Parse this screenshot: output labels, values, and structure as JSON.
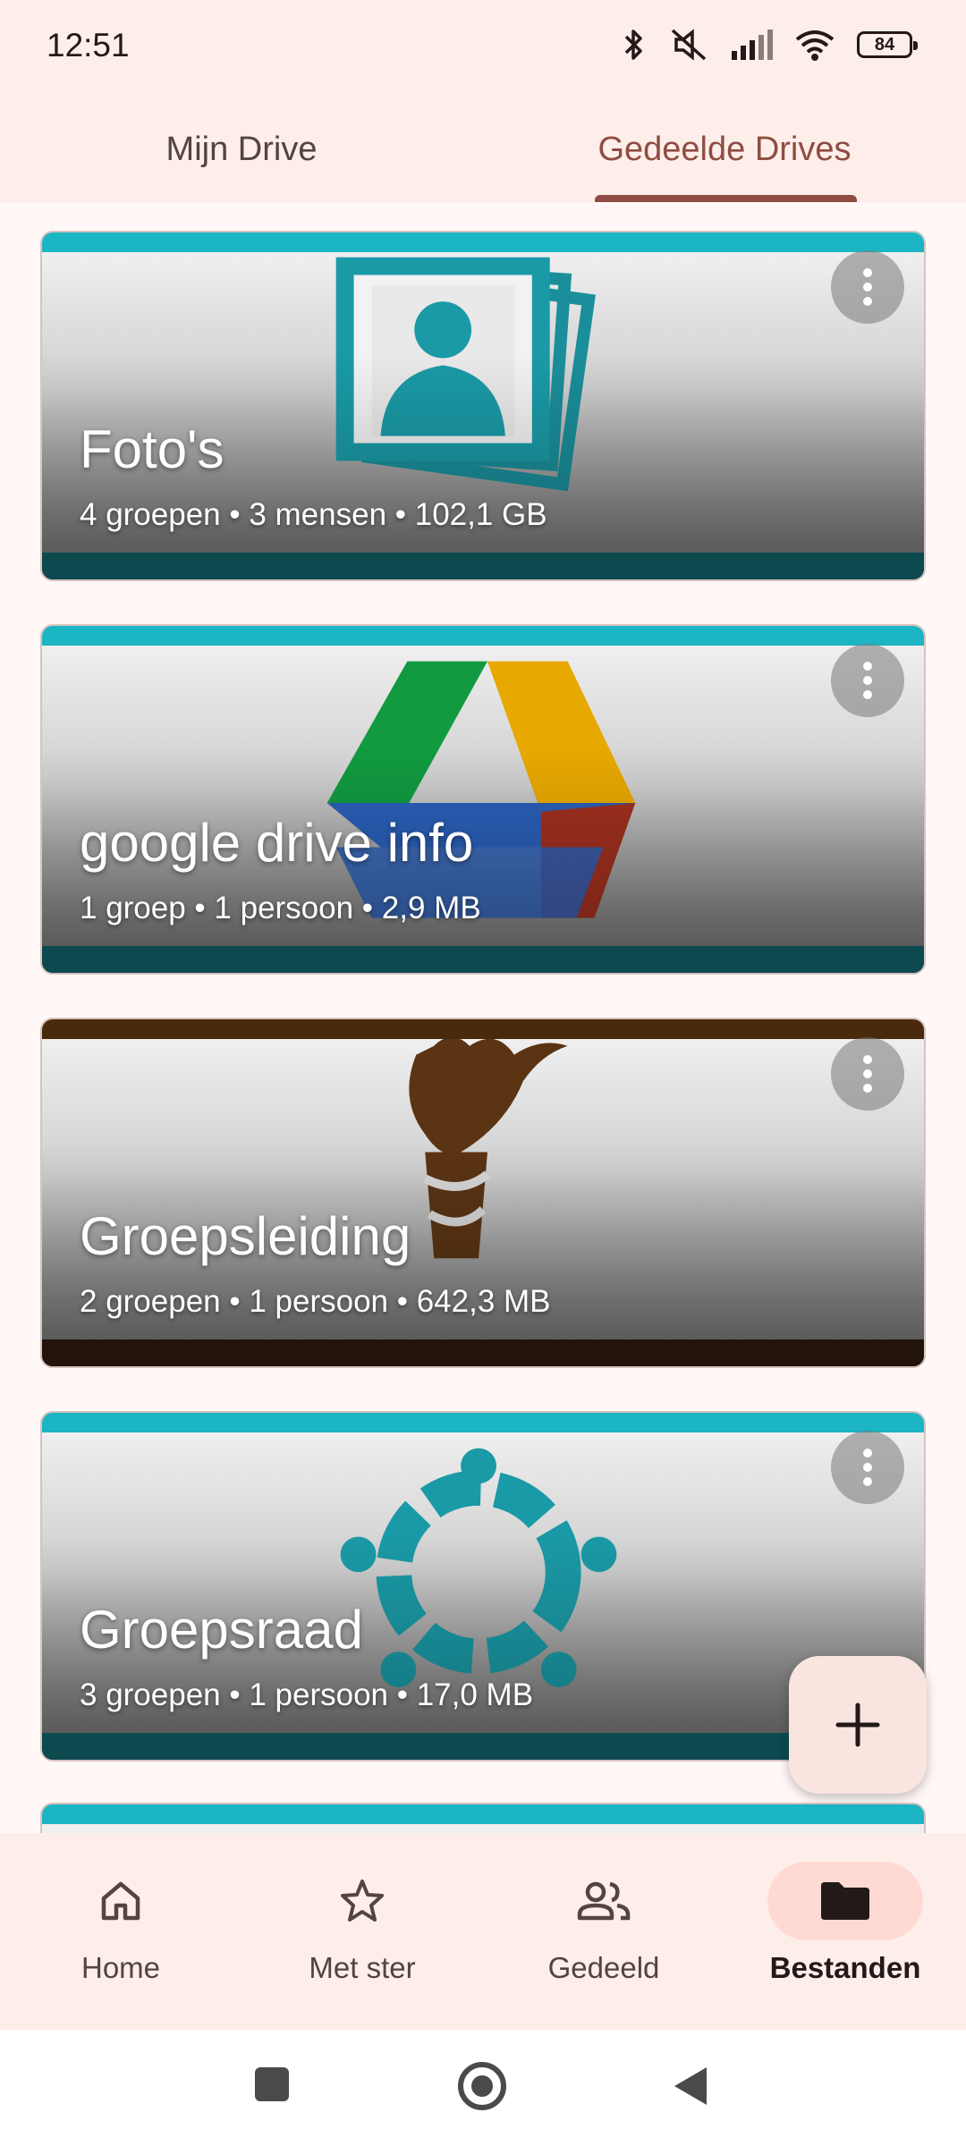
{
  "status_bar": {
    "time": "12:51",
    "battery": "84",
    "icons": [
      "bluetooth-icon",
      "mute-icon",
      "signal-icon",
      "wifi-icon",
      "battery-icon"
    ]
  },
  "tabs": [
    {
      "label": "Mijn Drive",
      "active": false
    },
    {
      "label": "Gedeelde Drives",
      "active": true
    }
  ],
  "drives": [
    {
      "title": "Foto's",
      "meta": "4 groepen • 3 mensen • 102,1 GB",
      "theme_color": "#1bb5c3",
      "art": "photos-icon"
    },
    {
      "title": "google drive info",
      "meta": "1 groep • 1 persoon • 2,9 MB",
      "theme_color": "#1bb5c3",
      "art": "google-drive-logo"
    },
    {
      "title": "Groepsleiding",
      "meta": "2 groepen • 1 persoon • 642,3 MB",
      "theme_color": "#4a2a0c",
      "art": "torch-icon"
    },
    {
      "title": "Groepsraad",
      "meta": "3 groepen • 1 persoon • 17,0 MB",
      "theme_color": "#1bb5c3",
      "art": "people-circle-icon"
    }
  ],
  "fab": {
    "icon": "plus-icon"
  },
  "bottom_nav": [
    {
      "label": "Home",
      "icon": "home-icon",
      "active": false
    },
    {
      "label": "Met ster",
      "icon": "star-icon",
      "active": false
    },
    {
      "label": "Gedeeld",
      "icon": "people-icon",
      "active": false
    },
    {
      "label": "Bestanden",
      "icon": "folder-icon",
      "active": true
    }
  ],
  "colors": {
    "accent": "#8f4c42",
    "surface": "#fdeeea",
    "teal": "#1bb5c3",
    "brown": "#4a2a0c"
  }
}
